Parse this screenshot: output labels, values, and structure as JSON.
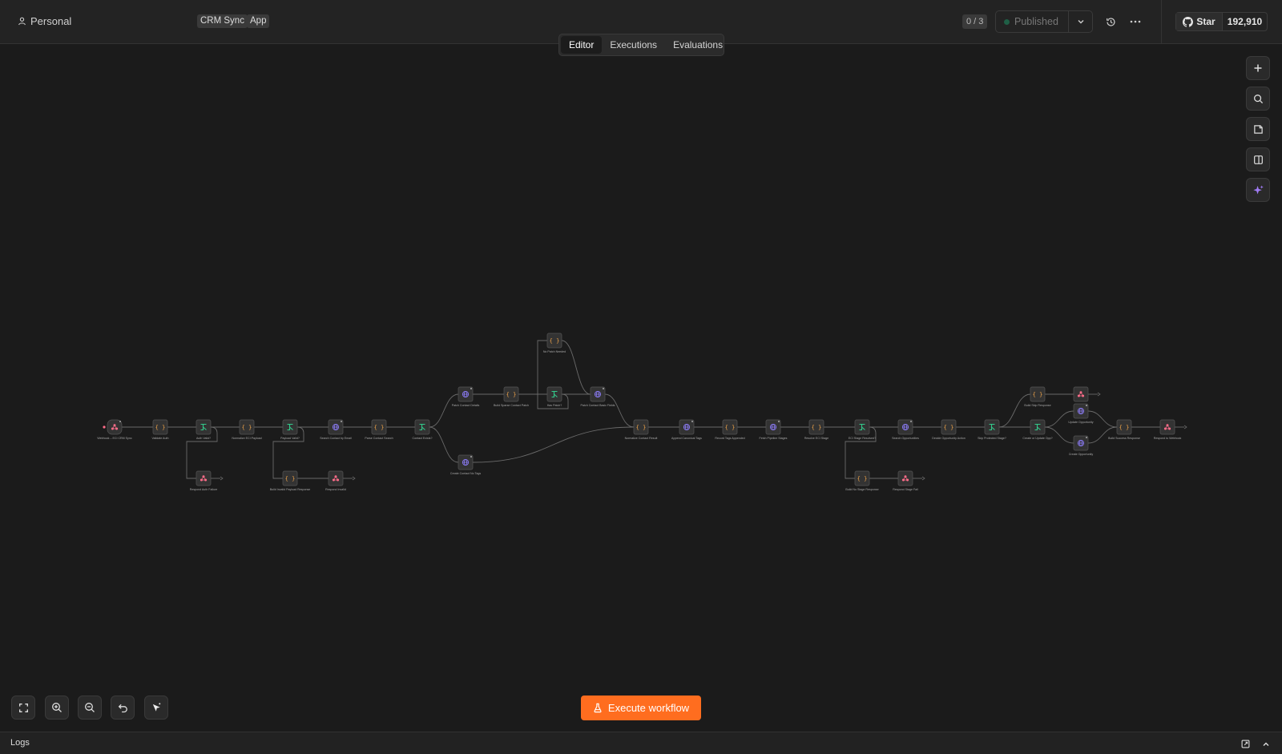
{
  "header": {
    "personal": "Personal",
    "tags": [
      "CRM Sync",
      "App"
    ],
    "counter": "0 / 3",
    "published": "Published",
    "github_star": "Star",
    "github_count": "192,910"
  },
  "tabs": [
    "Editor",
    "Executions",
    "Evaluations"
  ],
  "execute_label": "Execute workflow",
  "logs_label": "Logs",
  "colors": {
    "accent": "#ff6d1f",
    "node_bg": "#333333",
    "trigger": "#ff6d8a",
    "code": "#f0a44a",
    "branch": "#33c98a",
    "http": "#8b7bf5",
    "connector": "#6a6a6a"
  },
  "nodes": [
    {
      "type": "webhook",
      "label": "Webhook – ECI CRM Sync"
    },
    {
      "type": "code",
      "label": "Validate Auth"
    },
    {
      "type": "if",
      "label": "Auth Valid?"
    },
    {
      "type": "code",
      "label": "Normalize ECI Payload"
    },
    {
      "type": "if",
      "label": "Payload Valid?"
    },
    {
      "type": "http",
      "label": "Search Contact by Email"
    },
    {
      "type": "code",
      "label": "Parse Contact Search"
    },
    {
      "type": "if",
      "label": "Contact Exists?"
    },
    {
      "type": "http",
      "label": "Patch Contact Details"
    },
    {
      "type": "code",
      "label": "Build Sparse Contact Patch"
    },
    {
      "type": "code",
      "label": "No Patch Needed"
    },
    {
      "type": "if",
      "label": "Has Patch?"
    },
    {
      "type": "http",
      "label": "Patch Contact Basic Fields"
    },
    {
      "type": "http",
      "label": "Create Contact No Tags"
    },
    {
      "type": "code",
      "label": "Normalize Contact Result"
    },
    {
      "type": "http",
      "label": "Append Canonical Tags"
    },
    {
      "type": "code",
      "label": "Record Tags Appended"
    },
    {
      "type": "http",
      "label": "Fetch Pipeline Stages"
    },
    {
      "type": "code",
      "label": "Resolve ECI Stage"
    },
    {
      "type": "if",
      "label": "ECI Stage Resolved?"
    },
    {
      "type": "http",
      "label": "Search Opportunities"
    },
    {
      "type": "code",
      "label": "Decide Opportunity Action"
    },
    {
      "type": "if",
      "label": "Skip Protected Stage?"
    },
    {
      "type": "code",
      "label": "Build Skip Response"
    },
    {
      "type": "respond",
      "label": ""
    },
    {
      "type": "if",
      "label": "Create or Update Opp?"
    },
    {
      "type": "http",
      "label": "Update Opportunity"
    },
    {
      "type": "http",
      "label": "Create Opportunity"
    },
    {
      "type": "code",
      "label": "Build Success Response"
    },
    {
      "type": "respond",
      "label": "Respond to Webhook"
    },
    {
      "type": "respond",
      "label": "Respond Auth Failure"
    },
    {
      "type": "code",
      "label": "Build Invalid Payload Response"
    },
    {
      "type": "respond",
      "label": "Respond Invalid"
    },
    {
      "type": "code",
      "label": "Build No Stage Response"
    },
    {
      "type": "respond",
      "label": "Respond Stage Fail"
    }
  ]
}
